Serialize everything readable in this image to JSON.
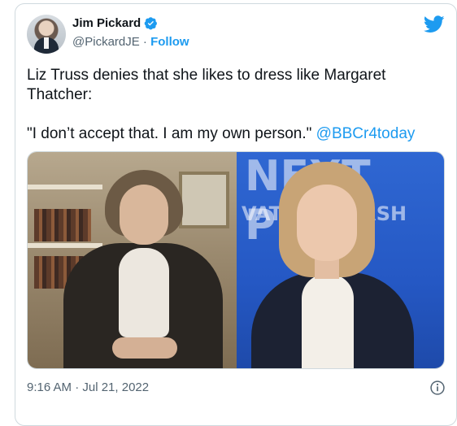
{
  "tweet": {
    "author_name": "Jim Pickard",
    "handle": "@PickardJE",
    "separator": " · ",
    "follow_label": "Follow",
    "text_main": "Liz Truss denies that she likes to dress like Margaret Thatcher:\n\n\"I don’t accept that. I am my own person.\" ",
    "mention": "@BBCr4today",
    "timestamp": "9:16 AM · Jul 21, 2022",
    "image_right_text_1": "NEXT PM",
    "image_right_text_2": "VATI    ADERSH"
  },
  "colors": {
    "accent": "#1d9bf0",
    "text": "#0f1419",
    "muted": "#536471",
    "border": "#cfd9de"
  },
  "icons": {
    "verified": "verified-badge-icon",
    "brand": "twitter-bird-icon",
    "info": "info-icon"
  }
}
